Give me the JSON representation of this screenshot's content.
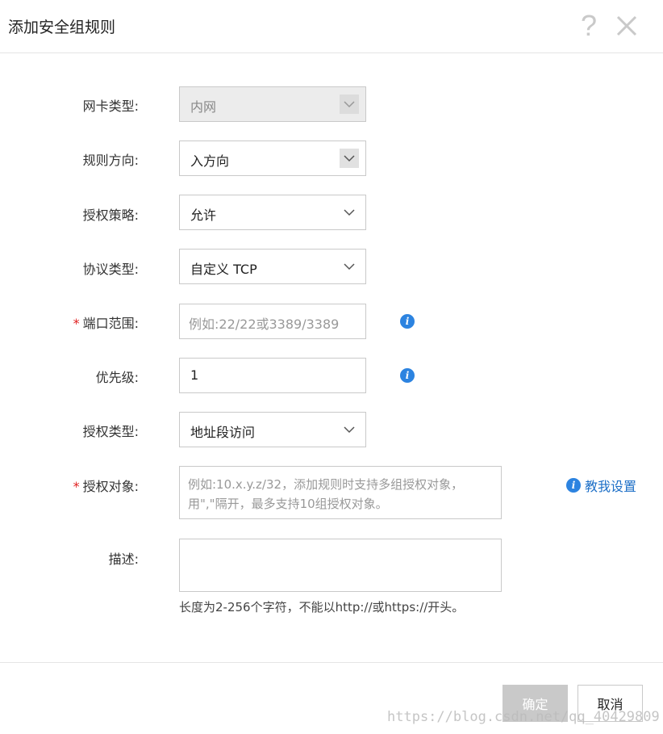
{
  "dialog": {
    "title": "添加安全组规则",
    "help_icon": "?"
  },
  "form": {
    "nic_type": {
      "label": "网卡类型:",
      "value": "内网"
    },
    "direction": {
      "label": "规则方向:",
      "value": "入方向"
    },
    "policy": {
      "label": "授权策略:",
      "value": "允许"
    },
    "protocol": {
      "label": "协议类型:",
      "value": "自定义 TCP"
    },
    "port_range": {
      "required_mark": "*",
      "label": "端口范围:",
      "placeholder": "例如:22/22或3389/3389",
      "info_icon": "i"
    },
    "priority": {
      "label": "优先级:",
      "value": "1",
      "info_icon": "i"
    },
    "auth_type": {
      "label": "授权类型:",
      "value": "地址段访问"
    },
    "auth_object": {
      "required_mark": "*",
      "label": "授权对象:",
      "placeholder": "例如:10.x.y.z/32，添加规则时支持多组授权对象，用\",\"隔开，最多支持10组授权对象。",
      "help_link": "教我设置",
      "info_icon": "i"
    },
    "description": {
      "label": "描述:",
      "hint": "长度为2-256个字符，不能以http://或https://开头。"
    }
  },
  "footer": {
    "ok_label": "确定",
    "cancel_label": "取消"
  },
  "watermark": "https://blog.csdn.net/qq_40429809",
  "colors": {
    "accent": "#2c83e0",
    "link": "#1d6fc7",
    "required": "#e02020",
    "disabled_button": "#c9c9c9"
  }
}
